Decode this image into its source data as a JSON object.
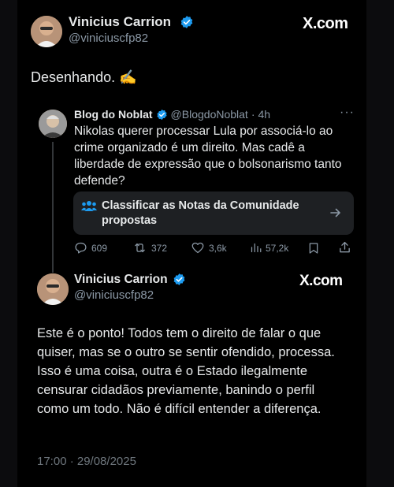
{
  "main_post": {
    "author_name": "Vinicius Carrion",
    "author_handle": "@viniciuscfp82",
    "brand": "X.com",
    "text": "Desenhando. ✍️"
  },
  "quoted_post": {
    "author_name": "Blog do Noblat",
    "author_handle": "@BlogdoNoblat",
    "time": "4h",
    "text": "Nikolas querer processar Lula por associá-lo ao crime organizado é um direito. Mas cadê a liberdade de expressão que o bolsonarismo tanto defende?",
    "community_notes_label": "Classificar as Notas da Comunidade propostas",
    "metrics": {
      "replies": "609",
      "reposts": "372",
      "likes": "3,6k",
      "views": "57,2k"
    }
  },
  "reply_post": {
    "author_name": "Vinicius Carrion",
    "author_handle": "@viniciuscfp82",
    "brand": "X.com",
    "text": "Este é o ponto! Todos tem o direito de falar o que quiser, mas se o outro se sentir ofendido, processa. Isso é uma coisa, outra é o Estado ilegalmente censurar cidadãos previamente, banindo o perfil como um todo. Não é difícil entender a diferença.",
    "timestamp": "17:00 · 29/08/2025"
  },
  "colors": {
    "background": "#000000",
    "text": "#e7e9ea",
    "secondary_text": "#8b98a5",
    "verified": "#1d9bf0",
    "notes_box": "#1e2023"
  },
  "icons": [
    "verified-badge-icon",
    "more-icon",
    "community-notes-icon",
    "arrow-right-icon",
    "reply-icon",
    "repost-icon",
    "like-icon",
    "views-icon",
    "bookmark-icon",
    "share-icon"
  ]
}
